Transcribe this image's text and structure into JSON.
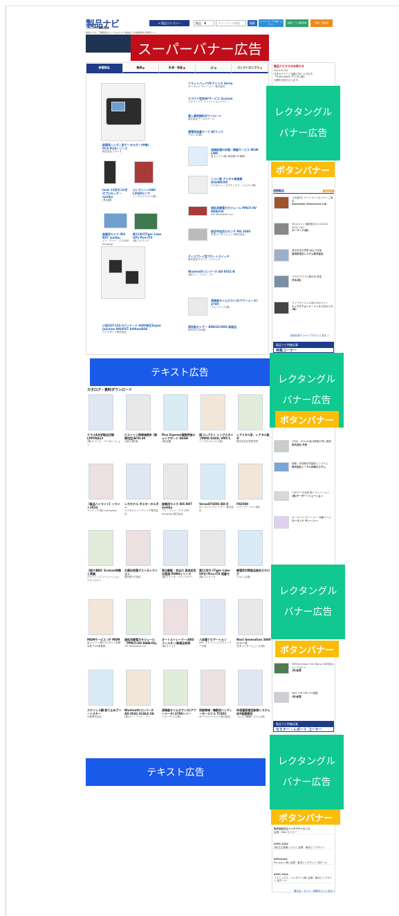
{
  "header": {
    "logo": "製品ナビ",
    "logo_sub": "powered by ",
    "logo_brand": "INCOM",
    "tagline": "製品ナビは、工業製品やエレクトロニクス製品などの技術者向け情報サイト",
    "category_button": "≡ 製品カテゴリー",
    "select_value": "製品",
    "search_placeholder": "フリーワード検索",
    "search_button": "検索",
    "buttons": [
      {
        "label": "スーパーサーチ 登録・ログイン",
        "color": "#2d8fd8"
      },
      {
        "label": "企業ページ 無料登録",
        "color": "#2ea56b"
      },
      {
        "label": "見積 一括依頼",
        "color": "#f08a1c"
      }
    ]
  },
  "super_banner": "スーパーバナー広告",
  "tabs": [
    {
      "label": "新着製品",
      "dot": ""
    },
    {
      "label": "機械",
      "dot": "#e0382c"
    },
    {
      "label": "計測・検査",
      "dot": "#e0382c"
    },
    {
      "label": "IT",
      "dot": "#2ea56b"
    },
    {
      "label": "エレクトロニクス",
      "dot": "#f0a01c"
    }
  ],
  "featured": [
    {
      "title": "耐環境ハンディ型データロガー(中略) PCS-PI1Eシリーズ",
      "company": "株式会社フローネ"
    },
    {
      "title": "Intel 13世代/12世代プロセッサー mailbo",
      "company": "(株)紹置"
    },
    {
      "title": "ロングレンジUAV LiDARセンサ",
      "company": "リーグルジャパン(株)"
    },
    {
      "title": "産業用カメラ IDS NXT malibu",
      "company": "アイ・ディー・エス(IDS Imaging)"
    },
    {
      "title": "第11世代Tiger Lake UP3 Pico-ITX",
      "company": "(株)コンテック"
    },
    {
      "title": "小型SOT-223-3パッケージ 600V耐圧Super Junction MOSFET 600ImxRD6",
      "company": "コアスタッフ株式会社"
    }
  ],
  "right_list": [
    {
      "title": "フラットベッドUVプリンタ Versa",
      "company": "ローランド ディー.ジー. 株式会社"
    },
    {
      "title": "クラウド型WAFサービス Scutum",
      "company": "パナソニック ソリューションテクノ..."
    },
    {
      "title": "導入事例無料ダウンロード",
      "company": "株式会社ワーススケール"
    },
    {
      "title": "導電性粘着テープ AFテック",
      "company": "アキレス(株)"
    },
    {
      "title": "遠隔設備の状態／稼働サービス MGM LINK",
      "company": "富士ソフト(株) 東京都 IoT機器"
    },
    {
      "title": "ニコン製 デジタル検査機 DIGIMICRO",
      "company": "エクセレン・オプティクス・ジャパン(株)"
    },
    {
      "title": "超低消費電力モジュール PMLTI HV ANALOG",
      "company": "ATI Worldwide LLC"
    },
    {
      "title": "航空宇宙用カセンサ MG 2000",
      "company": "日本ペーターヒュース株式会社"
    },
    {
      "title": "ディスプレイ型プロートスイッチ",
      "company": "株式会社ダブリン インテック"
    },
    {
      "title": "Bluetoothコンバータ AD-8541-B",
      "company": "(株)エー・アンド・デイ"
    },
    {
      "title": "高精度タイムカウンタ(アワーメータ) 4780",
      "company": "フォーテック(株)"
    },
    {
      "title": "高性能センサー BPACECOM2 新製品",
      "company": "BPACECOM(株)"
    }
  ],
  "text_ad_1": "テキスト広告",
  "text_ad_2": "テキスト広告",
  "catalog_heading": "カタログ・資料ダウンロード",
  "catalog": [
    {
      "title": "クラスA光学製品目録 LPPYRA13",
      "company": "(株)ケイエス・コーポレーション"
    },
    {
      "title": "ビルトイン熱帯価数計 (熱帯用型)BTH-30",
      "company": "大和工業(株)"
    },
    {
      "title": "Pico Express複数評価キャリアボード 8GHH",
      "company": "(株)紹置"
    },
    {
      "title": "超コンパクト シングルタイプMMS 8285L VMY-1",
      "company": "リーグルジャパン(株)"
    },
    {
      "title": "レアメタル系、レアタル鉱手",
      "company": "株式会社正鉄研究所"
    },
    {
      "title": "【製品ハイライト】イライト2024",
      "company": "コンテック(株) (conglass)"
    },
    {
      "title": "レガホテル ボスターホルダー",
      "company": "エクセルトレーディング株式会社"
    },
    {
      "title": "産業用カメラ IDS NXT malibu",
      "company": "アイ・ディー・エス (IDS Imaging) 株式会社"
    },
    {
      "title": "VersaSTUDIO BD-8",
      "company": "ローランド ディー.ジー. 株式会社"
    },
    {
      "title": "FN2500",
      "company": "シャープーイヤン(株)"
    },
    {
      "title": "【紹介資料】Scutum特徴と実績",
      "company": "パナソニック ソリューションテクノロジー"
    },
    {
      "title": "太陽光発電デストセレクション",
      "company": "鉄材電子(共和)"
    },
    {
      "title": "高分解能・多出力 直流安定化電源 PDMSシリーズ",
      "company": "(株)テクシオ・テクノロジー"
    },
    {
      "title": "第11世代 (Tiger Lake UP3) Pico-ITX 搭載モ",
      "company": "(株)コンテック"
    },
    {
      "title": "静電気対策製品総合カタログ",
      "company": "アキレス(株)"
    },
    {
      "title": "MGMサービス ×F MDM",
      "company": "富士ソフト(株)プロダクト事業本部 PQM事業部"
    },
    {
      "title": "超低消費電力モジュール「PMLTI-HV ANALOG」",
      "company": "ATI Worldwide LLC"
    },
    {
      "title": "オートストレーナー/ARSフィルター/新製品発表",
      "company": "(株)ストラテ"
    },
    {
      "title": "人体着ナビゲーション",
      "company": "NEC スマートイングストーリー代研"
    },
    {
      "title": "Next Generation 3000シリーズ",
      "company": "日本ペーターヒュース(株)"
    },
    {
      "title": "ステンレス鋼 耐り止めグリーンスチー",
      "company": "日新株式会社"
    },
    {
      "title": "Bluetoothコンバータ AD-8541-SCALE-2A",
      "company": "(株)エー・アンド・デイ"
    },
    {
      "title": "高精度タイムカウンタ(アワーメータ) 4780シリー",
      "company": "フォーテック(株)"
    },
    {
      "title": "同期帯域・機動用ハンディーターミナル TC801",
      "company": "ボーケウイジャパン株式会社"
    },
    {
      "title": "AI搭載脱着型新数システム AIX認識要定",
      "company": "コムエス情報システム(株)"
    }
  ],
  "sidebar": {
    "news_heading": "製品ナビからのお知らせ",
    "news": [
      "2024.05.09",
      "日本セミナーご活動に申し上げます。",
      "「ProductNavi デジタル版」",
      "公開をお知らせします。"
    ],
    "rect_ad_1": [
      "レクタングル",
      "バナー広告"
    ],
    "button_ad": "ボタンバナー",
    "ranking_heading": "週間製品",
    "ranking_badge": "製品記事",
    "ranking": [
      {
        "title": "【今週の】テードコートセミナーご案内",
        "company": "Rochester Electronics Ltd"
      },
      {
        "title": "3Dスキャン 最新型(X1) LGA5-B ESOL V(4)",
        "company": "ローランド(株)"
      },
      {
        "title": "直流安定化電源 高出力容量",
        "company": "直流安定化システム株式会社"
      },
      {
        "title": "プログラマブル素分泌 新型",
        "company": "日本(株)"
      },
      {
        "title": "ライフサイエンス向けLEDライト",
        "company": "ナックスフォード・インストロメンツ(株)"
      }
    ],
    "more_1": "製品記事ランキングをもっと見る »",
    "feature_heading": "特集コーナー",
    "feature_sub": "製品ナビ特集記事",
    "rect_ad_2": [
      "レクタングル",
      "バナー広告"
    ],
    "button_ad_2": "ボタンバナー",
    "mid_items": [
      {
        "title": "3次元・5Ghzの高分解能計測に最適",
        "company": "株式会社 末来"
      },
      {
        "title": "接触・非接触計測製品とシステム",
        "company": "株式会社トータル技術ロステム"
      },
      {
        "title": "CADデータ活用 新ソリューション",
        "company": "(株)テーダーソリューション"
      },
      {
        "title": "ローランド ディー.ジー. 特集ページ",
        "company": "ローランド ディー.ジー."
      }
    ],
    "rect_ad_3": [
      "レクタングル",
      "バナー広告"
    ],
    "button_ad_3": "ボタンバナー",
    "low_items": [
      {
        "title": "NVIDIA Jetson Orin Nano / NX対応キャリアボード",
        "company": "(株)紹置"
      },
      {
        "title": "WAF LPR RPR ITO搭載",
        "company": "(株)紹置"
      }
    ],
    "seminar_heading": "セミナー・レポート コーナー",
    "rect_ad_4": [
      "レクタングル",
      "バナー広告"
    ],
    "button_ad_4": "ボタンバナー",
    "events": [
      {
        "title": "株式会社日立ハイテクサイエンス",
        "company": "会場：Web セミナー"
      },
      {
        "title": "IIFES 2024",
        "company": "(株)日立産機システム 会場：東京ビッグサイト"
      },
      {
        "title": "IIFES2024",
        "company": "Pro-Aacs (株) 会場：東京ビッグサイト 西ホール"
      },
      {
        "title": "IIFES 2024",
        "company": "フエニックス・コンタクト(株) 会場：東京ビッグサイト 西ホール"
      }
    ],
    "more_2": "展示会・セミナー情報をもっと見る »"
  }
}
